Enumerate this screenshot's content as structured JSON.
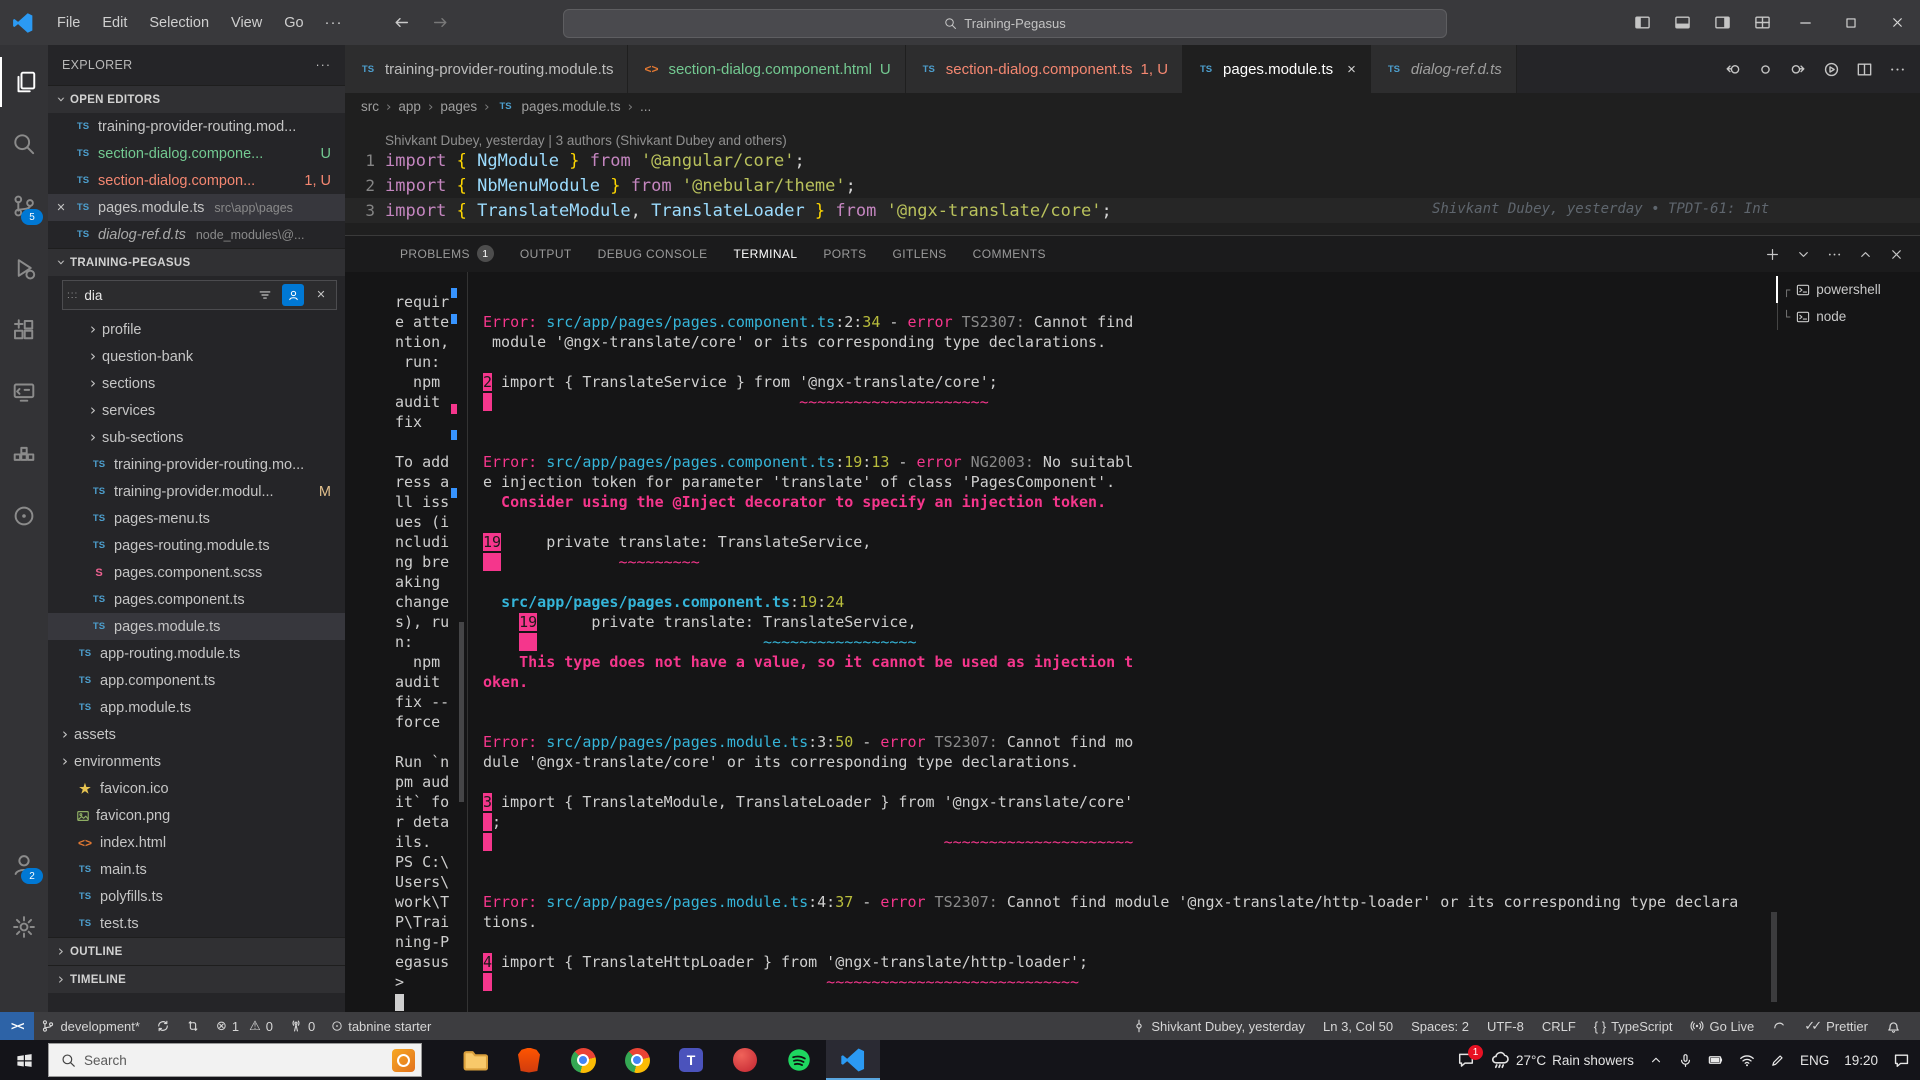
{
  "titlebar": {
    "menus": [
      "File",
      "Edit",
      "Selection",
      "View",
      "Go"
    ],
    "menu_more": "···",
    "search": "Training-Pegasus"
  },
  "activity": {
    "items": [
      {
        "icon": "files",
        "name": "explorer",
        "active": true
      },
      {
        "icon": "search",
        "name": "search"
      },
      {
        "icon": "source-control",
        "name": "source-control",
        "badge": "5"
      },
      {
        "icon": "run-debug",
        "name": "run-and-debug"
      },
      {
        "icon": "extensions",
        "name": "extensions"
      },
      {
        "icon": "remote",
        "name": "remote-explorer"
      },
      {
        "icon": "containers",
        "name": "containers"
      },
      {
        "icon": "circle",
        "name": "tabnine"
      }
    ],
    "bottom": [
      {
        "icon": "account",
        "name": "accounts",
        "badge": "2"
      },
      {
        "icon": "gear",
        "name": "settings"
      }
    ]
  },
  "sidebar": {
    "title": "EXPLORER",
    "open_editors_header": "OPEN EDITORS",
    "open_editors": [
      {
        "label": "training-provider-routing.mod...",
        "icon": "ts"
      },
      {
        "label": "section-dialog.compone...",
        "icon": "ts",
        "badge": "U",
        "cls": "green"
      },
      {
        "label": "section-dialog.compon...",
        "icon": "ts",
        "badge": "1, U",
        "cls": "red"
      },
      {
        "label": "pages.module.ts",
        "icon": "ts",
        "desc": "src\\app\\pages",
        "active": true,
        "close": true
      },
      {
        "label": "dialog-ref.d.ts",
        "icon": "ts",
        "desc": "node_modules\\@...",
        "italic": true
      }
    ],
    "project_header": "TRAINING-PEGASUS",
    "find_value": "dia",
    "tree": [
      {
        "label": "profile",
        "type": "folder",
        "indent": 2
      },
      {
        "label": "question-bank",
        "type": "folder",
        "indent": 2
      },
      {
        "label": "sections",
        "type": "folder",
        "indent": 2
      },
      {
        "label": "services",
        "type": "folder",
        "indent": 2
      },
      {
        "label": "sub-sections",
        "type": "folder",
        "indent": 2
      },
      {
        "label": "training-provider-routing.mo...",
        "type": "ts",
        "indent": 2
      },
      {
        "label": "training-provider.modul...",
        "type": "ts",
        "indent": 2,
        "badge": "M",
        "cls": "mod"
      },
      {
        "label": "pages-menu.ts",
        "type": "ts",
        "indent": 2
      },
      {
        "label": "pages-routing.module.ts",
        "type": "ts",
        "indent": 2
      },
      {
        "label": "pages.component.scss",
        "type": "scss",
        "indent": 2
      },
      {
        "label": "pages.component.ts",
        "type": "ts",
        "indent": 2
      },
      {
        "label": "pages.module.ts",
        "type": "ts",
        "indent": 2,
        "selected": true
      },
      {
        "label": "app-routing.module.ts",
        "type": "ts",
        "indent": 1
      },
      {
        "label": "app.component.ts",
        "type": "ts",
        "indent": 1
      },
      {
        "label": "app.module.ts",
        "type": "ts",
        "indent": 1
      },
      {
        "label": "assets",
        "type": "folder",
        "indent": 0
      },
      {
        "label": "environments",
        "type": "folder",
        "indent": 0
      },
      {
        "label": "favicon.ico",
        "type": "star",
        "indent": 1
      },
      {
        "label": "favicon.png",
        "type": "image",
        "indent": 1
      },
      {
        "label": "index.html",
        "type": "html",
        "indent": 1
      },
      {
        "label": "main.ts",
        "type": "ts",
        "indent": 1
      },
      {
        "label": "polyfills.ts",
        "type": "ts",
        "indent": 1
      },
      {
        "label": "test.ts",
        "type": "ts",
        "indent": 1
      }
    ],
    "outline": "OUTLINE",
    "timeline": "TIMELINE"
  },
  "tabs": [
    {
      "label": "training-provider-routing.module.ts",
      "icon": "ts"
    },
    {
      "label": "section-dialog.component.html",
      "icon": "html",
      "badge": "U",
      "cls": "green"
    },
    {
      "label": "section-dialog.component.ts",
      "icon": "ts",
      "badge": "1, U",
      "cls": "red"
    },
    {
      "label": "pages.module.ts",
      "icon": "ts",
      "active": true,
      "close": true
    },
    {
      "label": "dialog-ref.d.ts",
      "icon": "ts",
      "italic": true
    }
  ],
  "breadcrumb": [
    {
      "label": "src"
    },
    {
      "label": "app"
    },
    {
      "label": "pages"
    },
    {
      "label": "pages.module.ts",
      "icon": "ts"
    },
    {
      "label": "..."
    }
  ],
  "editor": {
    "codelens": "Shivkant Dubey, yesterday | 3 authors (Shivkant Dubey and others)",
    "blame": "Shivkant Dubey, yesterday • TPDT-61: Int",
    "lines": [
      {
        "n": "1",
        "segs": [
          [
            "kw",
            "import "
          ],
          [
            "pn",
            "{ "
          ],
          [
            "id",
            "NgModule "
          ],
          [
            "pn",
            "} "
          ],
          [
            "kw",
            "from "
          ],
          [
            "st",
            "'@angular/core'"
          ],
          [
            "pl",
            ";"
          ]
        ]
      },
      {
        "n": "2",
        "segs": [
          [
            "kw",
            "import "
          ],
          [
            "pn",
            "{ "
          ],
          [
            "id",
            "NbMenuModule "
          ],
          [
            "pn",
            "} "
          ],
          [
            "kw",
            "from "
          ],
          [
            "st",
            "'@nebular/theme'"
          ],
          [
            "pl",
            ";"
          ]
        ]
      },
      {
        "n": "3",
        "current": true,
        "segs": [
          [
            "kw",
            "import "
          ],
          [
            "pn",
            "{ "
          ],
          [
            "id",
            "TranslateModule"
          ],
          [
            "pl",
            ", "
          ],
          [
            "id",
            "TranslateLoader "
          ],
          [
            "pn",
            "} "
          ],
          [
            "kw",
            "from "
          ],
          [
            "st",
            "'@ngx-translate/core'"
          ],
          [
            "pl",
            ";"
          ]
        ]
      }
    ]
  },
  "panel": {
    "tabs": [
      {
        "label": "PROBLEMS",
        "badge": "1"
      },
      {
        "label": "OUTPUT"
      },
      {
        "label": "DEBUG CONSOLE"
      },
      {
        "label": "TERMINAL",
        "active": true
      },
      {
        "label": "PORTS"
      },
      {
        "label": "GITLENS"
      },
      {
        "label": "COMMENTS"
      }
    ]
  },
  "terminal": {
    "cursor_row": 35,
    "left": [
      "requir",
      "e atte",
      "ntion,",
      " run:",
      "  npm",
      "audit",
      "fix",
      "",
      "To add",
      "ress a",
      "ll iss",
      "ues (i",
      "ncludi",
      "ng bre",
      "aking",
      "change",
      "s), ru",
      "n:",
      "  npm",
      "audit",
      "fix --",
      "force",
      "",
      "Run `n",
      "pm aud",
      "it` fo",
      "r deta",
      "ils.",
      "PS C:\\",
      "Users\\",
      "work\\T",
      "P\\Trai",
      "ning-P",
      "egasus",
      ">",
      ""
    ],
    "rows": [
      [],
      [
        [
          "pk",
          "Error: "
        ],
        [
          "cy",
          "src/app/pages/pages.component.ts"
        ],
        [
          "w",
          ":2:"
        ],
        [
          "yl",
          "34"
        ],
        [
          "w",
          " - "
        ],
        [
          "pk",
          "error"
        ],
        [
          "gr",
          " TS2307: "
        ],
        [
          "w",
          "Cannot find"
        ]
      ],
      [
        [
          "w",
          " module '@ngx-translate/core' or its corresponding type declarations."
        ]
      ],
      [],
      [
        [
          "ln",
          "2"
        ],
        [
          "w",
          " import { TranslateService } from '@ngx-translate/core';"
        ]
      ],
      [
        [
          "lnc",
          "2"
        ],
        [
          "w",
          "                                  "
        ],
        [
          "sq",
          "~~~~~~~~~~~~~~~~~~~~~"
        ]
      ],
      [],
      [],
      [
        [
          "pk",
          "Error: "
        ],
        [
          "cy",
          "src/app/pages/pages.component.ts"
        ],
        [
          "w",
          ":"
        ],
        [
          "yl",
          "19"
        ],
        [
          "w",
          ":"
        ],
        [
          "yl",
          "13"
        ],
        [
          "w",
          " - "
        ],
        [
          "pk",
          "error"
        ],
        [
          "gr",
          " NG2003: "
        ],
        [
          "w",
          "No suitabl"
        ]
      ],
      [
        [
          "w",
          "e injection token for parameter 'translate' of class 'PagesComponent'."
        ]
      ],
      [
        [
          "pkb",
          "  Consider using the @Inject decorator to specify an injection token."
        ]
      ],
      [],
      [
        [
          "ln",
          "19"
        ],
        [
          "w",
          "     private translate: TranslateService,"
        ]
      ],
      [
        [
          "lnc",
          "19"
        ],
        [
          "w",
          "             "
        ],
        [
          "sq",
          "~~~~~~~~~"
        ]
      ],
      [],
      [
        [
          "w",
          "  "
        ],
        [
          "cyb",
          "src/app/pages/pages.component.ts"
        ],
        [
          "w",
          ":"
        ],
        [
          "yl",
          "19"
        ],
        [
          "w",
          ":"
        ],
        [
          "yl",
          "24"
        ]
      ],
      [
        [
          "w",
          "    "
        ],
        [
          "ln",
          "19"
        ],
        [
          "w",
          "      private translate: TranslateService,"
        ]
      ],
      [
        [
          "w",
          "    "
        ],
        [
          "lnc",
          "19"
        ],
        [
          "w",
          "                         "
        ],
        [
          "sqc",
          "~~~~~~~~~~~~~~~~~"
        ]
      ],
      [
        [
          "pkb",
          "    This type does not have a value, so it cannot be used as injection t"
        ]
      ],
      [
        [
          "pkb",
          "oken."
        ]
      ],
      [],
      [],
      [
        [
          "pk",
          "Error: "
        ],
        [
          "cy",
          "src/app/pages/pages.module.ts"
        ],
        [
          "w",
          ":3:"
        ],
        [
          "yl",
          "50"
        ],
        [
          "w",
          " - "
        ],
        [
          "pk",
          "error"
        ],
        [
          "gr",
          " TS2307: "
        ],
        [
          "w",
          "Cannot find mo"
        ]
      ],
      [
        [
          "w",
          "dule '@ngx-translate/core' or its corresponding type declarations."
        ]
      ],
      [],
      [
        [
          "ln",
          "3"
        ],
        [
          "w",
          " import { TranslateModule, TranslateLoader } from '@ngx-translate/core'"
        ]
      ],
      [
        [
          "lnc",
          "3"
        ],
        [
          "w",
          ";"
        ]
      ],
      [
        [
          "lnc",
          "3"
        ],
        [
          "w",
          "                                                  "
        ],
        [
          "sq",
          "~~~~~~~~~~~~~~~~~~~~~"
        ]
      ],
      [],
      [],
      [
        [
          "pk",
          "Error: "
        ],
        [
          "cy",
          "src/app/pages/pages.module.ts"
        ],
        [
          "w",
          ":4:"
        ],
        [
          "yl",
          "37"
        ],
        [
          "w",
          " - "
        ],
        [
          "pk",
          "error"
        ],
        [
          "gr",
          " TS2307: "
        ],
        [
          "w",
          "Cannot find module '@ngx-translate/http-loader' or its corresponding type declara"
        ]
      ],
      [
        [
          "w",
          "tions."
        ]
      ],
      [],
      [
        [
          "ln",
          "4"
        ],
        [
          "w",
          " import { TranslateHttpLoader } from '@ngx-translate/http-loader';"
        ]
      ],
      [
        [
          "lnc",
          "4"
        ],
        [
          "w",
          "                                     "
        ],
        [
          "sq",
          "~~~~~~~~~~~~~~~~~~~~~~~~~~~~"
        ]
      ],
      []
    ],
    "list": [
      {
        "label": "powershell",
        "selected": true
      },
      {
        "label": "node"
      }
    ]
  },
  "status": {
    "remote": "><",
    "branch": "development*",
    "errors": "1",
    "warnings": "0",
    "tower": "0",
    "tabnine": "tabnine starter",
    "blame": "Shivkant Dubey, yesterday",
    "line_col": "Ln 3, Col 50",
    "spaces": "Spaces: 2",
    "encoding": "UTF-8",
    "eol": "CRLF",
    "braces": "{ }",
    "language": "TypeScript",
    "golive": "Go Live",
    "prettier": "Prettier"
  },
  "taskbar": {
    "search": "Search",
    "apps": [
      "file-explorer",
      "brave",
      "chrome",
      "chrome-2",
      "teams",
      "app-red",
      "spotify",
      "vscode"
    ],
    "chat_badge": "1",
    "weather_temp": "27°C",
    "weather_desc": "Rain showers",
    "lang": "ENG",
    "time": "19:20"
  }
}
